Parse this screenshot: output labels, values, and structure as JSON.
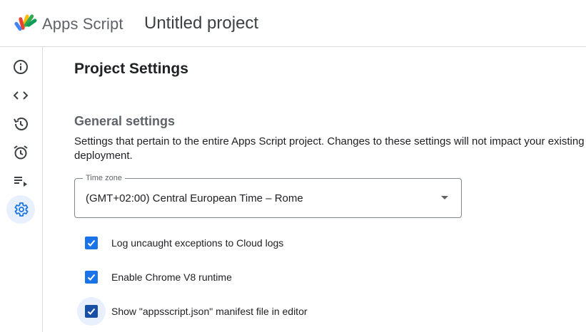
{
  "header": {
    "brand": "Apps Script",
    "project_title": "Untitled project",
    "logo_icon": "apps-script-logo"
  },
  "rail": {
    "items": [
      {
        "name": "overview",
        "icon": "info-icon",
        "active": false
      },
      {
        "name": "editor",
        "icon": "code-icon",
        "active": false
      },
      {
        "name": "executions-history",
        "icon": "history-icon",
        "active": false
      },
      {
        "name": "triggers",
        "icon": "alarm-clock-icon",
        "active": false
      },
      {
        "name": "executions",
        "icon": "playlist-play-icon",
        "active": false
      },
      {
        "name": "project-settings",
        "icon": "gear-icon",
        "active": true
      }
    ]
  },
  "main": {
    "page_title": "Project Settings",
    "general": {
      "title": "General settings",
      "description": "Settings that pertain to the entire Apps Script project. Changes to these settings will not impact your existing deployment."
    },
    "timezone": {
      "label": "Time zone",
      "value": "(GMT+02:00) Central European Time – Rome"
    },
    "checkboxes": [
      {
        "label": "Log uncaught exceptions to Cloud logs",
        "checked": true
      },
      {
        "label": "Enable Chrome V8 runtime",
        "checked": true
      },
      {
        "label": "Show \"appsscript.json\" manifest file in editor",
        "checked": true
      }
    ]
  },
  "colors": {
    "accent": "#1a73e8",
    "active_bg": "#e8f0fe",
    "icon_gray": "#5f6368"
  }
}
